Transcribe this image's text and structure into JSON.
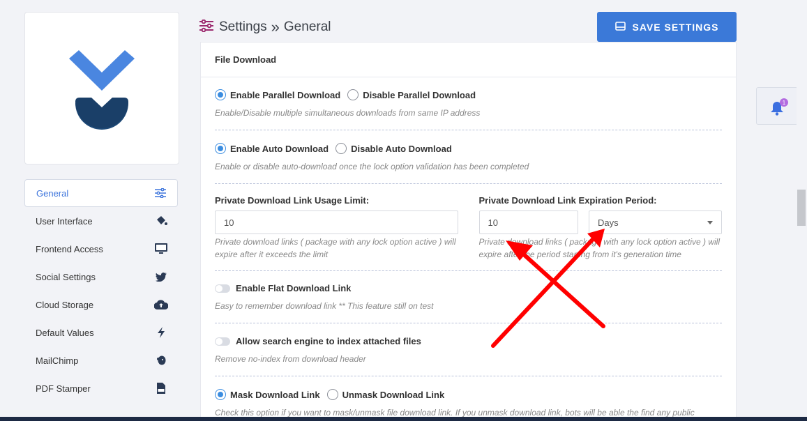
{
  "header": {
    "section": "Settings",
    "separator": "»",
    "page": "General",
    "save_label": "SAVE SETTINGS"
  },
  "sidebar": {
    "items": [
      {
        "label": "General",
        "icon": "sliders-icon",
        "active": true
      },
      {
        "label": "User Interface",
        "icon": "paint-bucket-icon"
      },
      {
        "label": "Frontend Access",
        "icon": "monitor-icon"
      },
      {
        "label": "Social Settings",
        "icon": "twitter-icon"
      },
      {
        "label": "Cloud Storage",
        "icon": "cloud-upload-icon"
      },
      {
        "label": "Default Values",
        "icon": "bolt-icon"
      },
      {
        "label": "MailChimp",
        "icon": "mailchimp-icon"
      },
      {
        "label": "PDF Stamper",
        "icon": "pdf-file-icon"
      }
    ]
  },
  "panel": {
    "title": "File Download",
    "parallel": {
      "enable_label": "Enable Parallel Download",
      "disable_label": "Disable Parallel Download",
      "hint": "Enable/Disable multiple simultaneous downloads from same IP address"
    },
    "auto": {
      "enable_label": "Enable Auto Download",
      "disable_label": "Disable Auto Download",
      "hint": "Enable or disable auto-download once the lock option validation has been completed"
    },
    "usage_limit": {
      "label": "Private Download Link Usage Limit:",
      "value": "10",
      "hint": "Private download links ( package with any lock option active ) will expire after it exceeds the limit"
    },
    "expiration": {
      "label": "Private Download Link Expiration Period:",
      "value": "10",
      "unit": "Days",
      "hint": "Private download links ( package with any lock option active ) will expire after the period starting from it's generation time"
    },
    "flat_link": {
      "label": "Enable Flat Download Link",
      "hint": "Easy to remember download link ** This feature still on test"
    },
    "index_files": {
      "label": "Allow search engine to index attached files",
      "hint": "Remove no-index from download header"
    },
    "mask": {
      "mask_label": "Mask Download Link",
      "unmask_label": "Unmask Download Link",
      "hint": "Check this option if you want to mask/unmask file download link. If you unmask download link, bots will be able the find any public download link easily."
    }
  },
  "notification": {
    "count": "1"
  },
  "colors": {
    "accent": "#3b79d8",
    "annotation": "#ff0000"
  }
}
